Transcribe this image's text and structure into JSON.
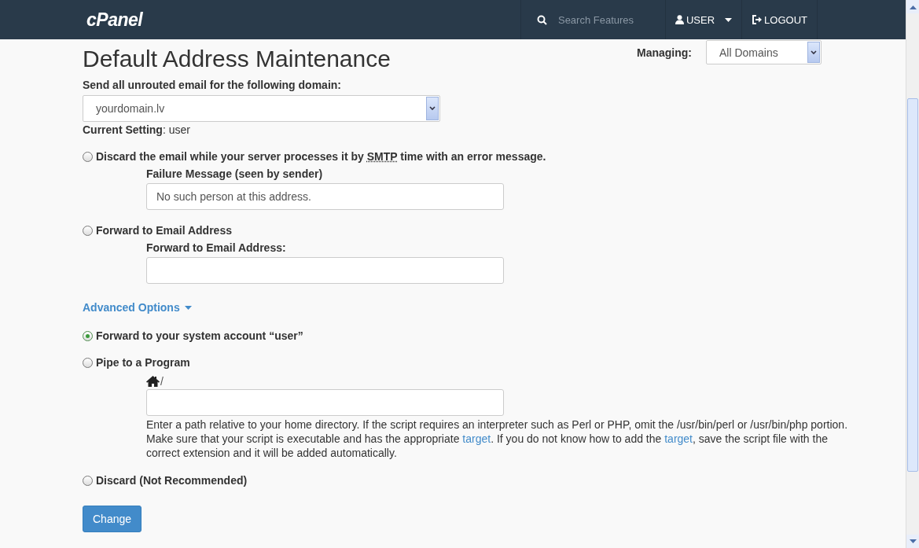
{
  "header": {
    "logo": "cPanel",
    "search": {
      "placeholder": "Search Features"
    },
    "user": "USER",
    "logout": "LOGOUT"
  },
  "title": "Default Address Maintenance",
  "managing": {
    "label": "Managing:",
    "value": "All Domains"
  },
  "domain": {
    "label": "Send all unrouted email for the following domain:",
    "value": "yourdomain.lv"
  },
  "current_setting": {
    "label": "Current Setting",
    "value": ": user"
  },
  "basic_options": [
    {
      "kind": "field",
      "selected": false,
      "label_parts": [
        {
          "kind": "text",
          "text": "Discard the email while your server processes it by "
        },
        {
          "kind": "abbr",
          "text": "SMTP"
        },
        {
          "kind": "text",
          "text": " time with an error message."
        }
      ],
      "field_label": "Failure Message (seen by sender)",
      "value": "No such person at this address."
    },
    {
      "kind": "field",
      "selected": false,
      "label_parts": [
        {
          "kind": "text",
          "text": "Forward to Email Address"
        }
      ],
      "field_label": "Forward to Email Address:"
    }
  ],
  "advanced": {
    "label": "Advanced Options"
  },
  "advanced_options": [
    {
      "kind": "plain",
      "selected": true,
      "label_parts": [
        {
          "kind": "text",
          "text": "Forward to your system account “user”"
        }
      ]
    },
    {
      "kind": "pipe",
      "selected": false,
      "label_parts": [
        {
          "kind": "text",
          "text": "Pipe to a Program"
        }
      ],
      "path_prefix": "/",
      "help": [
        {
          "kind": "text",
          "text": "Enter a path relative to your home directory. If the script requires an interpreter such as Perl or PHP, omit the /usr/bin/perl or /usr/bin/php portion. Make sure that your script is executable and has the appropriate "
        },
        {
          "kind": "link",
          "text": "target"
        },
        {
          "kind": "text",
          "text": ". If you do not know how to add the "
        },
        {
          "kind": "link",
          "text": "target"
        },
        {
          "kind": "text",
          "text": ", save the script file with the correct extension and it will be added automatically."
        }
      ]
    },
    {
      "kind": "plain",
      "selected": false,
      "label_parts": [
        {
          "kind": "text",
          "text": "Discard (Not Recommended)"
        }
      ]
    }
  ],
  "submit": "Change"
}
